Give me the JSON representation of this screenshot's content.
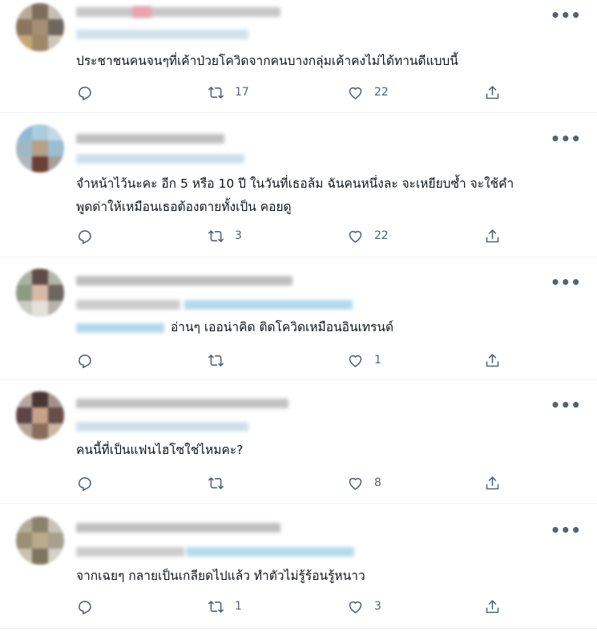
{
  "tweets": [
    {
      "text": "ประชาชนคนจนๆที่เค้าป่วยโควิดจากคนบางกลุ่มเค้าคงไม่ได้ทานดีแบบนี้",
      "replies": "",
      "retweets": "17",
      "likes": "22"
    },
    {
      "text": "จำหน้าไว้นะคะ อีก 5 หรือ 10 ปี ในวันที่เธอล้ม ฉันคนหนึ่งละ จะเหยียบซ้ำ จะใช้คำ\nพูดด่าให้เหมือนเธอต้องตายทั้งเป็น คอยดู",
      "replies": "",
      "retweets": "3",
      "likes": "22"
    },
    {
      "text": "อ่านๆ เออน่าคิด ติดโควิดเหมือนอินเทรนด์",
      "replies": "",
      "retweets": "",
      "likes": "1"
    },
    {
      "text": "คนนี้ที่เป็นแฟนไฮโซใช่ไหมคะ?",
      "replies": "",
      "retweets": "",
      "likes": "8"
    },
    {
      "text": "จากเฉยๆ กลายเป็นเกลียดไปแล้ว ทำตัวไม่รู้ร้อนรู้หนาว",
      "replies": "",
      "retweets": "1",
      "likes": "3"
    }
  ],
  "icons": {
    "reply": "reply-icon",
    "retweet": "retweet-icon",
    "like": "like-icon",
    "share": "share-icon",
    "more": "more-icon"
  },
  "colors": {
    "text": "#0f1419",
    "secondary": "#536471",
    "divider": "#eff3f4",
    "blurred_name": "#b8b8b8",
    "blurred_handle": "#a9d6ee"
  }
}
